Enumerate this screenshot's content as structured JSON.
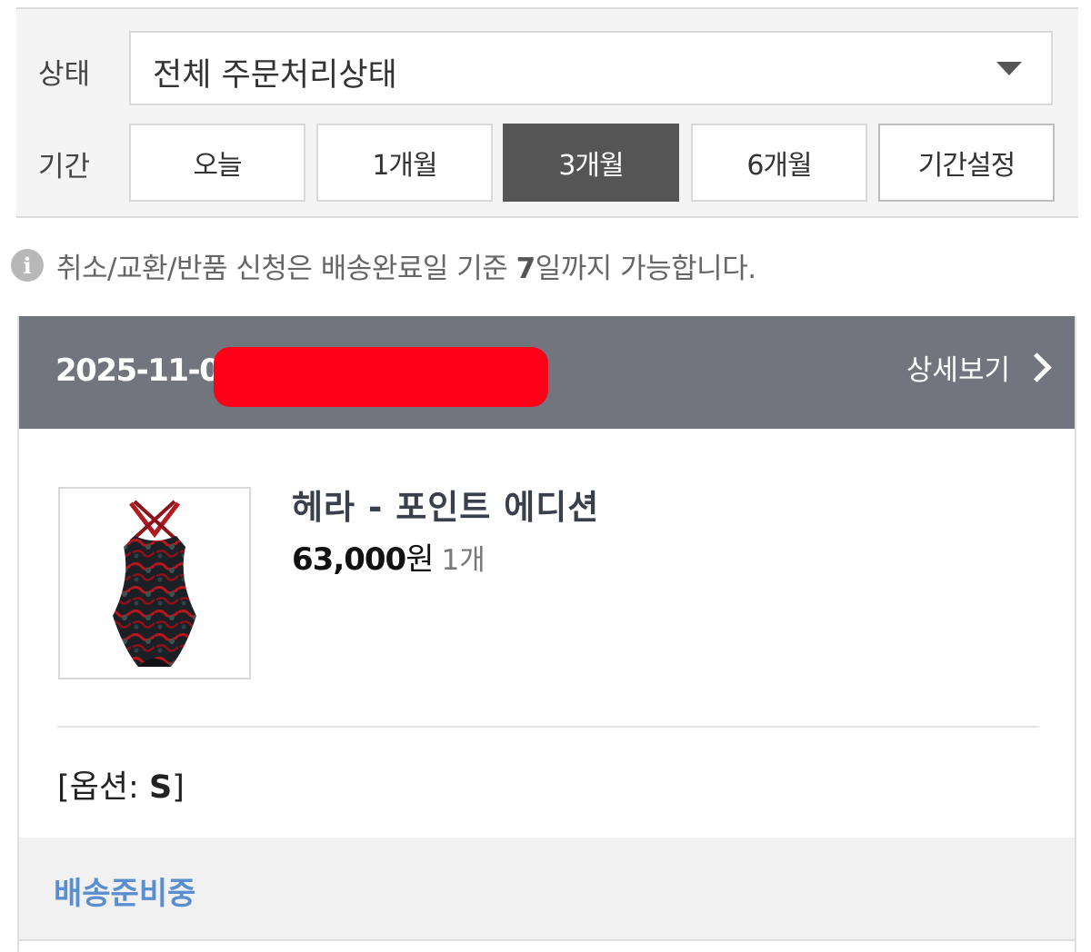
{
  "filters": {
    "status_label": "상태",
    "status_value": "전체 주문처리상태",
    "period_label": "기간",
    "periods": [
      "오늘",
      "1개월",
      "3개월",
      "6개월",
      "기간설정"
    ],
    "active_period": "3개월"
  },
  "notice": {
    "text_before": "취소/교환/반품 신청은 배송완료일 기준 ",
    "days": "7",
    "text_after": "일까지 가능합니다."
  },
  "order": {
    "date": "2025-11-03",
    "detail_label": "상세보기",
    "product": {
      "name": "헤라 - 포인트 에디션",
      "price": "63,000",
      "currency": "원",
      "quantity": "1개",
      "option_prefix": "[옵션: ",
      "option_value": "S",
      "option_suffix": "]"
    },
    "delivery_status": "배송준비중"
  },
  "colors": {
    "header_bg": "#73757e",
    "active_period_bg": "#555555",
    "delivery_status": "#5b8ecf",
    "redaction": "#ff0019"
  }
}
